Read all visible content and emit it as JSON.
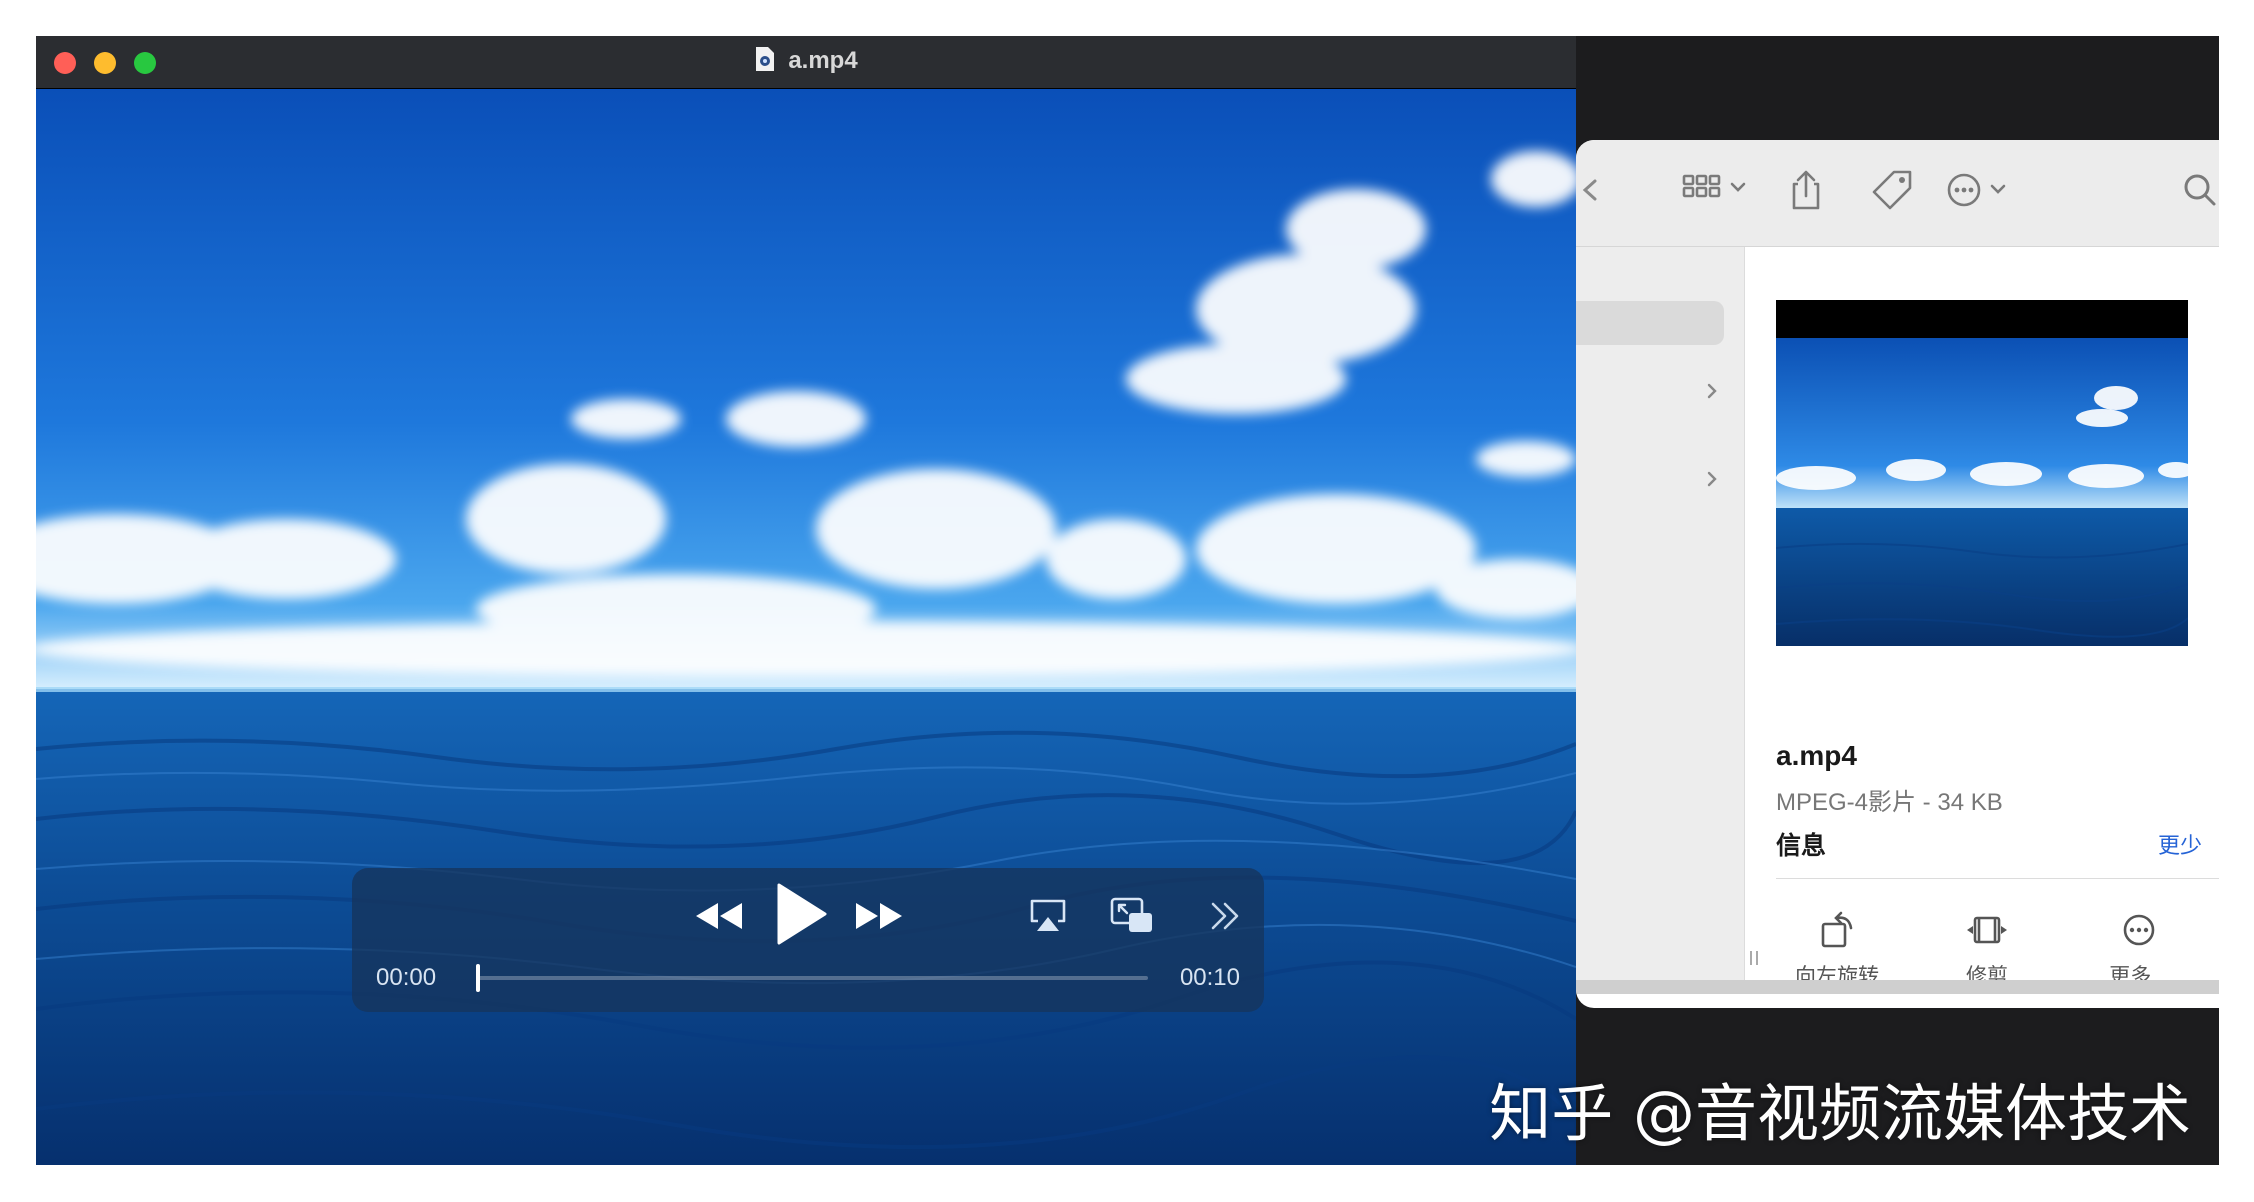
{
  "player": {
    "title": "a.mp4",
    "current_time": "00:00",
    "duration": "00:10",
    "progress": 0
  },
  "finder": {
    "preview": {
      "file_name": "a.mp4",
      "file_meta": "MPEG-4影片 - 34 KB",
      "info_label": "信息",
      "less_label": "更少"
    },
    "actions": [
      {
        "label": "向左旋转",
        "icon": "rotate-left-icon"
      },
      {
        "label": "修剪",
        "icon": "trim-icon"
      },
      {
        "label": "更多...",
        "icon": "more-icon"
      }
    ]
  },
  "watermark": "知乎 @音视频流媒体技术",
  "colors": {
    "traffic_red": "#ff5f57",
    "traffic_yellow": "#febc2e",
    "traffic_green": "#28c840",
    "link_blue": "#2563d6"
  }
}
